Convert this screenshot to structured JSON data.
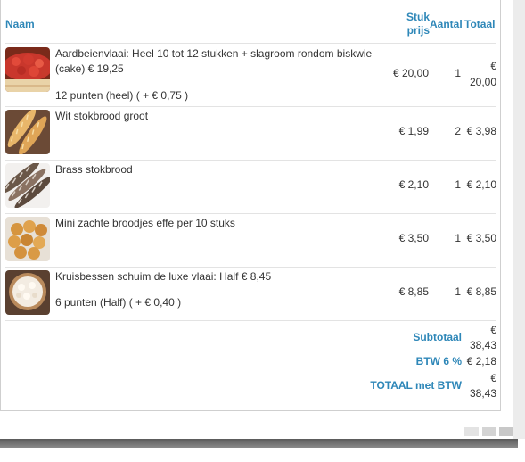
{
  "table": {
    "headers": {
      "name": "Naam",
      "unit_price_1": "Stuk",
      "unit_price_2": "prijs",
      "qty": "Aantal",
      "total": "Totaal"
    },
    "rows": [
      {
        "name_line1": "Aardbeienvlaai: Heel 10 tot 12 stukken + slagroom rondom biskwie",
        "name_line2": "(cake) € 19,25",
        "option": "12 punten (heel) ( + € 0,75 )",
        "unit_price": "€ 20,00",
        "qty": "1",
        "total_a": "€",
        "total_b": "20,00",
        "thumb_icon": "strawberry-flan-image"
      },
      {
        "name_line1": "Wit stokbrood groot",
        "unit_price": "€ 1,99",
        "qty": "2",
        "total": "€ 3,98",
        "thumb_icon": "white-baguette-image"
      },
      {
        "name_line1": "Brass stokbrood",
        "unit_price": "€ 2,10",
        "qty": "1",
        "total": "€ 2,10",
        "thumb_icon": "brass-baguette-image"
      },
      {
        "name_line1": "Mini zachte broodjes effe per 10 stuks",
        "unit_price": "€ 3,50",
        "qty": "1",
        "total": "€ 3,50",
        "thumb_icon": "mini-rolls-image"
      },
      {
        "name_line1": "Kruisbessen schuim de luxe vlaai: Half € 8,45",
        "option": "6 punten (Half) ( + € 0,40 )",
        "unit_price": "€ 8,85",
        "qty": "1",
        "total": "€ 8,85",
        "thumb_icon": "gooseberry-meringue-flan-image"
      }
    ]
  },
  "totals": {
    "subtotal_label": "Subtotaal",
    "subtotal_a": "€",
    "subtotal_b": "38,43",
    "vat_label": "BTW 6 %",
    "vat_value": "€ 2,18",
    "grand_label": "TOTAAL met BTW",
    "grand_a": "€",
    "grand_b": "38,43"
  },
  "colors": {
    "accent": "#2e87b8",
    "text": "#333333",
    "separator": "#e3e3e3"
  }
}
